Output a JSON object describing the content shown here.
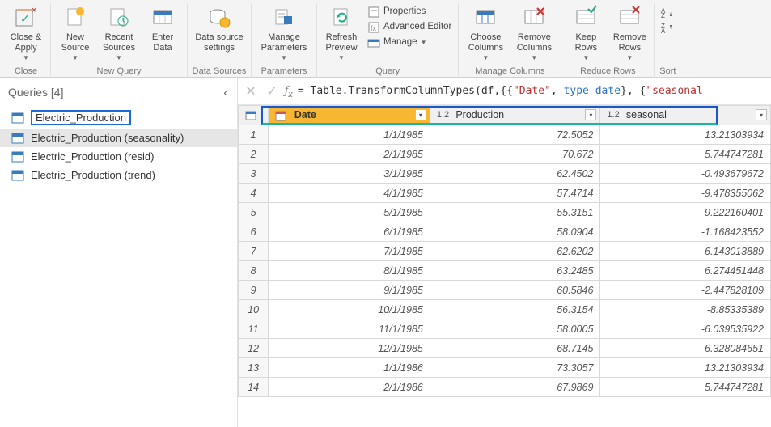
{
  "ribbon": {
    "close_apply": "Close &\nApply",
    "new_source": "New\nSource",
    "recent_sources": "Recent\nSources",
    "enter_data": "Enter\nData",
    "data_source_settings": "Data source\nsettings",
    "manage_parameters": "Manage\nParameters",
    "refresh_preview": "Refresh\nPreview",
    "properties": "Properties",
    "advanced_editor": "Advanced Editor",
    "manage": "Manage",
    "choose_columns": "Choose\nColumns",
    "remove_columns": "Remove\nColumns",
    "keep_rows": "Keep\nRows",
    "remove_rows": "Remove\nRows",
    "group_close": "Close",
    "group_newquery": "New Query",
    "group_datasources": "Data Sources",
    "group_parameters": "Parameters",
    "group_query": "Query",
    "group_managecolumns": "Manage Columns",
    "group_reducerows": "Reduce Rows",
    "group_sort": "Sort"
  },
  "queries": {
    "header": "Queries [4]",
    "items": [
      {
        "label": "Electric_Production"
      },
      {
        "label": "Electric_Production (seasonality)"
      },
      {
        "label": "Electric_Production (resid)"
      },
      {
        "label": "Electric_Production (trend)"
      }
    ]
  },
  "formula": {
    "prefix": "= Table.TransformColumnTypes(df,{{",
    "s1": "\"Date\"",
    "mid1": ", ",
    "kw1": "type date",
    "mid2": "}, {",
    "s2": "\"seasonal"
  },
  "columns": {
    "date": "Date",
    "production": "Production",
    "seasonal": "seasonal"
  },
  "rows": [
    {
      "n": "1",
      "date": "1/1/1985",
      "production": "72.5052",
      "seasonal": "13.21303934"
    },
    {
      "n": "2",
      "date": "2/1/1985",
      "production": "70.672",
      "seasonal": "5.744747281"
    },
    {
      "n": "3",
      "date": "3/1/1985",
      "production": "62.4502",
      "seasonal": "-0.493679672"
    },
    {
      "n": "4",
      "date": "4/1/1985",
      "production": "57.4714",
      "seasonal": "-9.478355062"
    },
    {
      "n": "5",
      "date": "5/1/1985",
      "production": "55.3151",
      "seasonal": "-9.222160401"
    },
    {
      "n": "6",
      "date": "6/1/1985",
      "production": "58.0904",
      "seasonal": "-1.168423552"
    },
    {
      "n": "7",
      "date": "7/1/1985",
      "production": "62.6202",
      "seasonal": "6.143013889"
    },
    {
      "n": "8",
      "date": "8/1/1985",
      "production": "63.2485",
      "seasonal": "6.274451448"
    },
    {
      "n": "9",
      "date": "9/1/1985",
      "production": "60.5846",
      "seasonal": "-2.447828109"
    },
    {
      "n": "10",
      "date": "10/1/1985",
      "production": "56.3154",
      "seasonal": "-8.85335389"
    },
    {
      "n": "11",
      "date": "11/1/1985",
      "production": "58.0005",
      "seasonal": "-6.039535922"
    },
    {
      "n": "12",
      "date": "12/1/1985",
      "production": "68.7145",
      "seasonal": "6.328084651"
    },
    {
      "n": "13",
      "date": "1/1/1986",
      "production": "73.3057",
      "seasonal": "13.21303934"
    },
    {
      "n": "14",
      "date": "2/1/1986",
      "production": "67.9869",
      "seasonal": "5.744747281"
    }
  ]
}
